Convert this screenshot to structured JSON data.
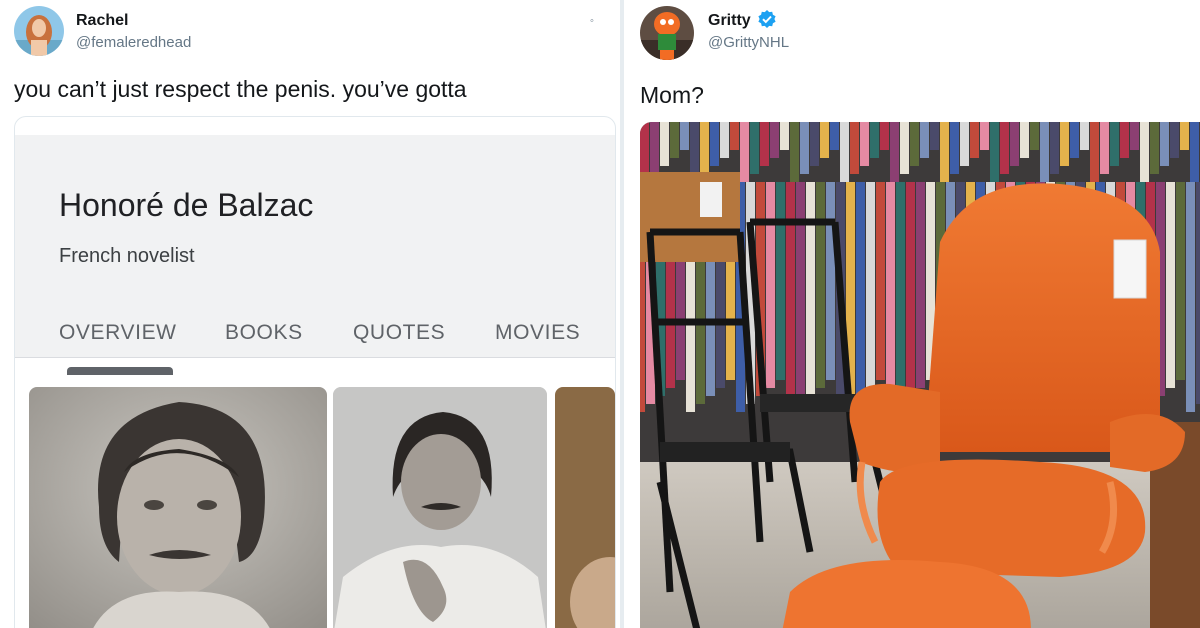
{
  "tweet_left": {
    "author_name": "Rachel",
    "author_handle": "@femaleredhead",
    "text": "you can’t just respect the penis. you’ve gotta",
    "caret_icon": "chevron-down-icon",
    "knowledge_card": {
      "title": "Honoré de Balzac",
      "subtitle": "French novelist",
      "tabs": [
        {
          "label": "OVERVIEW",
          "selected": true
        },
        {
          "label": "BOOKS",
          "selected": false
        },
        {
          "label": "QUOTES",
          "selected": false
        },
        {
          "label": "MOVIES",
          "selected": false
        }
      ],
      "tab_color": "#5f6368"
    }
  },
  "tweet_right": {
    "author_name": "Gritty",
    "author_handle": "@GrittyNHL",
    "verified": true,
    "verified_color": "#1da1f2",
    "text": "Mom?"
  }
}
